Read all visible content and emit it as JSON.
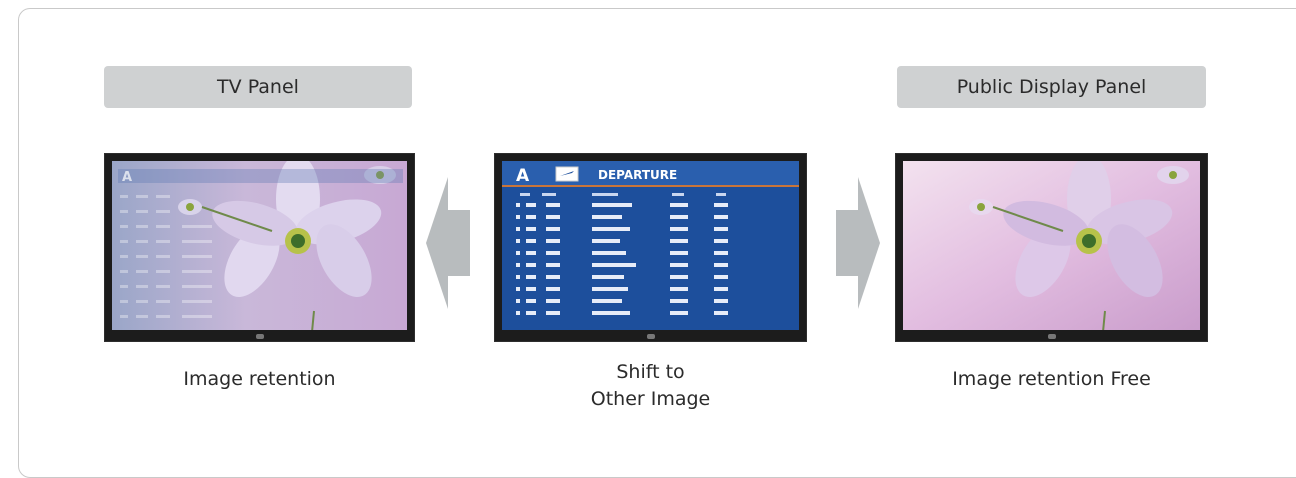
{
  "left_panel": {
    "tag": "TV Panel",
    "caption": "Image retention",
    "ghost_letter": "A"
  },
  "center_panel": {
    "board_letter": "A",
    "board_title": "DEPARTURE",
    "caption_line1": "Shift to",
    "caption_line2": "Other Image"
  },
  "right_panel": {
    "tag": "Public Display Panel",
    "caption": "Image retention Free"
  },
  "colors": {
    "tag_bg": "#cfd1d2",
    "arrow": "#b8bcbe",
    "board_blue": "#1d4f9c",
    "flower_bg": "#e6c3e3"
  }
}
